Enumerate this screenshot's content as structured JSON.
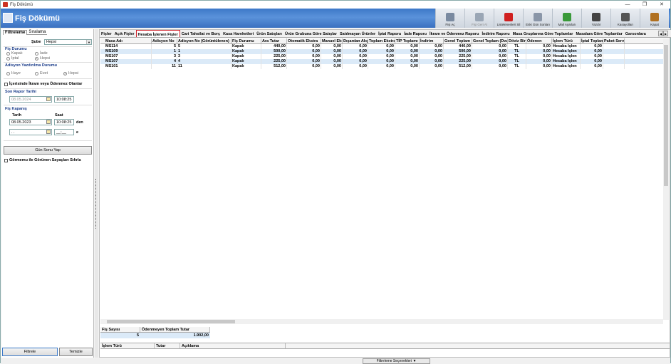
{
  "window": {
    "title": "Fiş Dökümü",
    "controls": [
      "—",
      "❐",
      "✕"
    ]
  },
  "header": {
    "title": "Fiş Dökümü"
  },
  "toolbar": [
    {
      "label": "Fişi Aç",
      "icon": "receipt-open-icon",
      "color": "#7a8aa0",
      "enabled": true
    },
    {
      "label": "Fişi Geri Al",
      "icon": "undo-receipt-icon",
      "color": "#9aa6b5",
      "enabled": false
    },
    {
      "label": "Listelenenleri Sil",
      "icon": "delete-icon",
      "color": "#d02020",
      "enabled": true
    },
    {
      "label": "Eski Gün Sonları",
      "icon": "archive-icon",
      "color": "#8a96a8",
      "enabled": true
    },
    {
      "label": "Mail Ayarları",
      "icon": "mail-settings-icon",
      "color": "#3a9a3a",
      "enabled": true
    },
    {
      "label": "Yazdır",
      "icon": "printer-icon",
      "color": "#444444",
      "enabled": true
    },
    {
      "label": "Kasayolları",
      "icon": "cash-drawer-icon",
      "color": "#555555",
      "enabled": true
    },
    {
      "label": "Kapat",
      "icon": "exit-door-icon",
      "color": "#b07020",
      "enabled": true
    }
  ],
  "left": {
    "tabs": [
      "Filtreleme",
      "Sıralama"
    ],
    "sube_label": "Şube",
    "sube_value": "Hepsi",
    "fis_durumu_label": "Fiş Durumu",
    "fis_durumu_opts": [
      "Kapalı",
      "İade",
      "İptal",
      "Hepsi"
    ],
    "adisyon_label": "Adisyon Yazdırılma Durumu",
    "adisyon_opts": [
      "Hayır",
      "Evet",
      "Hepsi"
    ],
    "ikram_chk": "İçerisinde İkram veya Ödenmez Olanlar",
    "son_rapor_label": "Son Rapor Tarihi",
    "son_rapor_date": "08.05.2024",
    "son_rapor_time": "10:08:25",
    "fis_kapanis_label": "Fiş Kapanış",
    "tarih_label": "Tarih",
    "saat_label": "Saat",
    "from_date": "08.05.2023",
    "from_time": "10:08:25",
    "den": "den",
    "to_date": ". .",
    "to_time": "__:__",
    "e": "e",
    "gun_sonu_btn": "Gün Sonu Yap",
    "gormunu_chk": "Görmemu ile Görünen Sayaçları Sıfırla",
    "filtrele_btn": "Filtrele",
    "temizle_btn": "Temizle"
  },
  "tabs": [
    "Fişler",
    "Açık Fişler",
    "Hesaba İşlenen Fişler",
    "Cari Tahsilat ve Borç",
    "Kasa Hareketleri",
    "Ürün Satışları",
    "Ürün Grubuna Göre Satışlar",
    "Satılmayan Ürünler",
    "İptal Raporu",
    "İade Raporu",
    "İkram ve Ödenmez Raporu",
    "İndirim Raporu",
    "Masa Gruplarına Göre Toplamlar",
    "Masalara Göre Toplamlar",
    "Garsonlara"
  ],
  "active_tab": 2,
  "grid": {
    "columns": [
      "Masa Adı",
      "Adisyon No",
      "Adisyon No (Görüntülenen)",
      "Fiş Durumu",
      "Ara Tutar",
      "Otomatik Ekstra",
      "Manuel Ekstra",
      "Dışardan Alış",
      "Toplam Ekstra",
      "TİP Toplamı",
      "İndirim",
      "Genel Toplam",
      "Genel Toplam (Dvz)",
      "Döviz Birimi",
      "Ödenen",
      "İşlem Türü",
      "İptal Toplamı",
      "Paket Servis"
    ],
    "rows": [
      [
        "MS114",
        "5",
        "5",
        "Kapalı",
        "440,00",
        "0,00",
        "0,00",
        "0,00",
        "0,00",
        "0,00",
        "0,00",
        "440,00",
        "0,00",
        "TL",
        "0,00",
        "Hesaba İşlen",
        "0,00",
        ""
      ],
      [
        "MS109",
        "1",
        "1",
        "Kapalı",
        "500,00",
        "0,00",
        "0,00",
        "0,00",
        "0,00",
        "0,00",
        "0,00",
        "500,00",
        "0,00",
        "TL",
        "0,00",
        "Hesaba İşlen",
        "0,00",
        ""
      ],
      [
        "MS107",
        "3",
        "3",
        "Kapalı",
        "225,00",
        "0,00",
        "0,00",
        "0,00",
        "0,00",
        "0,00",
        "0,00",
        "225,00",
        "0,00",
        "TL",
        "0,00",
        "Hesaba İşlen",
        "0,00",
        ""
      ],
      [
        "MS107",
        "4",
        "4",
        "Kapalı",
        "225,00",
        "0,00",
        "0,00",
        "0,00",
        "0,00",
        "0,00",
        "0,00",
        "225,00",
        "0,00",
        "TL",
        "0,00",
        "Hesaba İşlen",
        "0,00",
        ""
      ],
      [
        "MS101",
        "11",
        "11",
        "Kapalı",
        "512,00",
        "0,00",
        "0,00",
        "0,00",
        "0,00",
        "0,00",
        "0,00",
        "512,00",
        "0,00",
        "TL",
        "0,00",
        "Hesaba İşlen",
        "0,00",
        ""
      ]
    ]
  },
  "summary": {
    "h1": "Fiş Sayısı",
    "h2": "Ödenmeyen Toplam Tutar",
    "v1": "5",
    "v2": "1.902,00"
  },
  "detail": {
    "columns": [
      "İşlem Türü",
      "Tutar",
      "Açıklama"
    ]
  },
  "status": {
    "filter_button": "Filtreleme Seçenekleri ▼"
  }
}
